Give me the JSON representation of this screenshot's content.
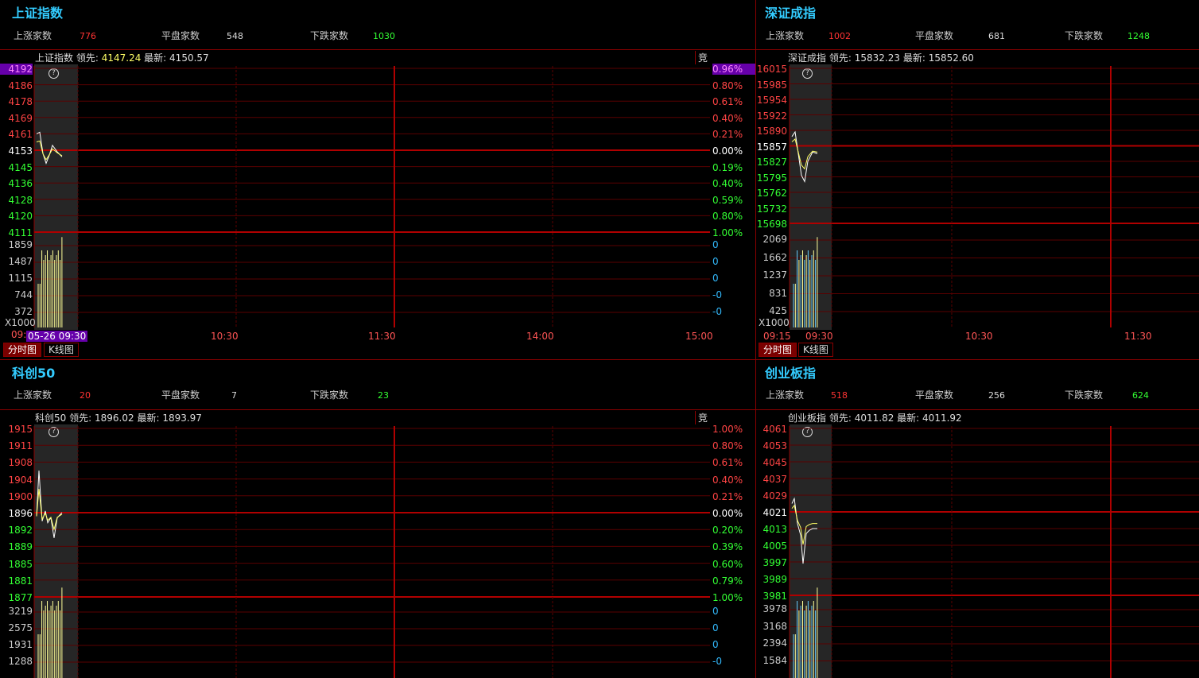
{
  "panels": [
    {
      "title": "上证指数",
      "stats": [
        {
          "label": "上涨家数",
          "value": "776",
          "cls": "up"
        },
        {
          "label": "平盘家数",
          "value": "548",
          "cls": "flat"
        },
        {
          "label": "下跌家数",
          "value": "1030",
          "cls": "down"
        }
      ],
      "info": {
        "name": "上证指数",
        "lead_label": "领先:",
        "lead": "4147.24",
        "latest_label": "最新:",
        "latest": "4150.57"
      },
      "jing": "竞",
      "left_axis": [
        "4192",
        "4186",
        "4178",
        "4169",
        "4161",
        "4153",
        "4145",
        "4136",
        "4128",
        "4120",
        "4111"
      ],
      "right_axis": [
        "0.96%",
        "0.80%",
        "0.61%",
        "0.40%",
        "0.21%",
        "0.00%",
        "0.19%",
        "0.40%",
        "0.59%",
        "0.80%",
        "1.00%"
      ],
      "vol_axis": [
        "1859",
        "1487",
        "1115",
        "744",
        "372"
      ],
      "vol_right": [
        "0",
        "0",
        "0",
        "-0",
        "-0"
      ],
      "vol_unit": "X1000",
      "time_labels": [
        "05-26 09:30",
        "10:30",
        "11:30",
        "14:00",
        "15:00"
      ],
      "time_first_cut": "09:",
      "tabs": [
        "分时图",
        "K线图"
      ]
    },
    {
      "title": "深证成指",
      "stats": [
        {
          "label": "上涨家数",
          "value": "1002",
          "cls": "up"
        },
        {
          "label": "平盘家数",
          "value": "681",
          "cls": "flat"
        },
        {
          "label": "下跌家数",
          "value": "1248",
          "cls": "down"
        }
      ],
      "info": {
        "name": "深证成指",
        "lead_label": "领先:",
        "lead": "15832.23",
        "latest_label": "最新:",
        "latest": "15852.60"
      },
      "left_axis": [
        "16015",
        "15985",
        "15954",
        "15922",
        "15890",
        "15857",
        "15827",
        "15795",
        "15762",
        "15732",
        "15698"
      ],
      "vol_axis": [
        "2069",
        "1662",
        "1237",
        "831",
        "425"
      ],
      "vol_unit": "X1000",
      "time_labels": [
        "09:15",
        "09:30",
        "10:30",
        "11:30"
      ],
      "tabs": [
        "分时图",
        "K线图"
      ]
    },
    {
      "title": "科创50",
      "stats": [
        {
          "label": "上涨家数",
          "value": "20",
          "cls": "up"
        },
        {
          "label": "平盘家数",
          "value": "7",
          "cls": "flat"
        },
        {
          "label": "下跌家数",
          "value": "23",
          "cls": "down"
        }
      ],
      "info": {
        "name": "科创50",
        "lead_label": "领先:",
        "lead": "1896.02",
        "latest_label": "最新:",
        "latest": "1893.97"
      },
      "jing": "竞",
      "left_axis": [
        "1915",
        "1911",
        "1908",
        "1904",
        "1900",
        "1896",
        "1892",
        "1889",
        "1885",
        "1881",
        "1877"
      ],
      "right_axis": [
        "1.00%",
        "0.80%",
        "0.61%",
        "0.40%",
        "0.21%",
        "0.00%",
        "0.20%",
        "0.39%",
        "0.60%",
        "0.79%",
        "1.00%"
      ],
      "vol_axis": [
        "3219",
        "2575",
        "1931",
        "1288"
      ],
      "vol_right": [
        "0",
        "0",
        "0",
        "-0"
      ]
    },
    {
      "title": "创业板指",
      "stats": [
        {
          "label": "上涨家数",
          "value": "518",
          "cls": "up"
        },
        {
          "label": "平盘家数",
          "value": "256",
          "cls": "flat"
        },
        {
          "label": "下跌家数",
          "value": "624",
          "cls": "down"
        }
      ],
      "info": {
        "name": "创业板指",
        "lead_label": "领先:",
        "lead": "4011.82",
        "latest_label": "最新:",
        "latest": "4011.92"
      },
      "left_axis": [
        "4061",
        "4053",
        "4045",
        "4037",
        "4029",
        "4021",
        "4013",
        "4005",
        "3997",
        "3989",
        "3981"
      ],
      "vol_axis": [
        "3978",
        "3168",
        "2394",
        "1584"
      ]
    }
  ],
  "help_glyph": "?",
  "colors": {
    "background": "#000000",
    "grid": "#8b0000",
    "title": "#33ccff",
    "up": "#ff3333",
    "down": "#33ff33",
    "price_line": "#ffffff",
    "avg_line": "#ffff66"
  }
}
